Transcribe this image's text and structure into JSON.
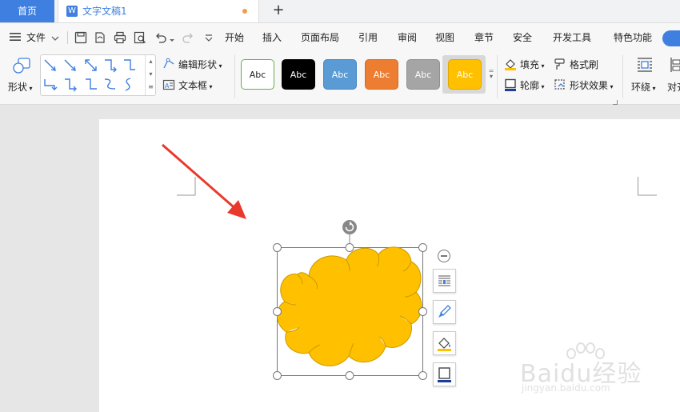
{
  "tabs": {
    "home_label": "首页",
    "doc_icon": "W",
    "doc_title": "文字文稿1",
    "new_tab": "+"
  },
  "menu": {
    "file_label": "文件",
    "items": [
      "开始",
      "插入",
      "页面布局",
      "引用",
      "审阅",
      "视图",
      "章节",
      "安全",
      "开发工具",
      "特色功能"
    ]
  },
  "ribbon": {
    "shape_label": "形状",
    "edit_shape_label": "编辑形状",
    "textbox_label": "文本框",
    "styles": [
      {
        "text": "Abc",
        "bg": "#ffffff",
        "fg": "#222222",
        "border": "#6aaa4a"
      },
      {
        "text": "Abc",
        "bg": "#000000",
        "fg": "#ffffff",
        "border": "#000000"
      },
      {
        "text": "Abc",
        "bg": "#5b9bd5",
        "fg": "#ffffff",
        "border": "#4a86bd"
      },
      {
        "text": "Abc",
        "bg": "#ed7d31",
        "fg": "#ffffff",
        "border": "#d56a22"
      },
      {
        "text": "Abc",
        "bg": "#a5a5a5",
        "fg": "#ffffff",
        "border": "#8f8f8f"
      },
      {
        "text": "Abc",
        "bg": "#ffc000",
        "fg": "#ffffff",
        "border": "#e0a800"
      }
    ],
    "fill_label": "填充",
    "outline_label": "轮廓",
    "format_painter_label": "格式刷",
    "shape_effect_label": "形状效果",
    "wrap_label": "环绕",
    "align_label": "对齐"
  },
  "canvas": {
    "cloud_fill": "#ffc000",
    "cloud_stroke": "#c99a00",
    "arrow_color": "#e8392c"
  },
  "watermark": {
    "brand": "Baidu经验",
    "url": "jingyan.baidu.com"
  }
}
